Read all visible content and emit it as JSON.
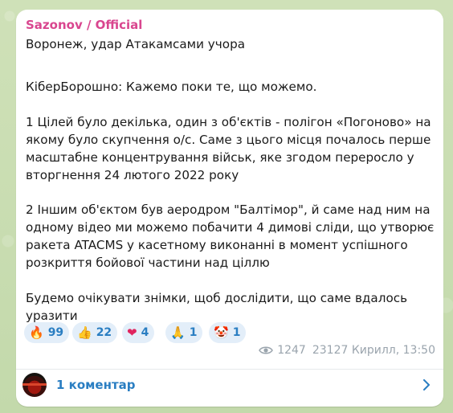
{
  "channel": {
    "author": "Sazonov / Official",
    "author_color": "#d9468f"
  },
  "message": {
    "lines": [
      "Воронеж, удар Атакамсами учора",
      "",
      "КіберБорошно: Кажемо поки те, що можемо.",
      "",
      "1 Цілей було декілька, один з об'єктів - полігон «Погоново» на",
      "якому було скупчення о/с. Саме з цього місця почалось перше",
      "масштабне концентрування військ, яке згодом переросло у",
      "вторгнення 24 лютого 2022 року",
      "",
      "2 Іншим об'єктом був аеродром \"Балтімор\", й саме над ним на",
      "одному відео ми можемо побачити 4 димові сліди, що утворює",
      "ракета ATACMS у касетному виконанні в момент успішного",
      "розкриття бойової частини над ціллю",
      "",
      "Будемо очікувати знімки, щоб дослідити, що саме вдалось",
      "уразити"
    ]
  },
  "reactions": [
    {
      "icon": "fire-icon",
      "emoji": "🔥",
      "count": "99"
    },
    {
      "icon": "thumbs-up-icon",
      "emoji": "👍",
      "count": "22"
    },
    {
      "icon": "heart-icon",
      "emoji": "❤",
      "count": "4"
    },
    {
      "icon": "pray-icon",
      "emoji": "🙏",
      "count": "1"
    },
    {
      "icon": "clown-icon",
      "emoji": "🤡",
      "count": "1"
    }
  ],
  "meta": {
    "views": "1247",
    "signature": "23127 Кирилл, 13:50"
  },
  "comments": {
    "label": "1 коментар"
  }
}
